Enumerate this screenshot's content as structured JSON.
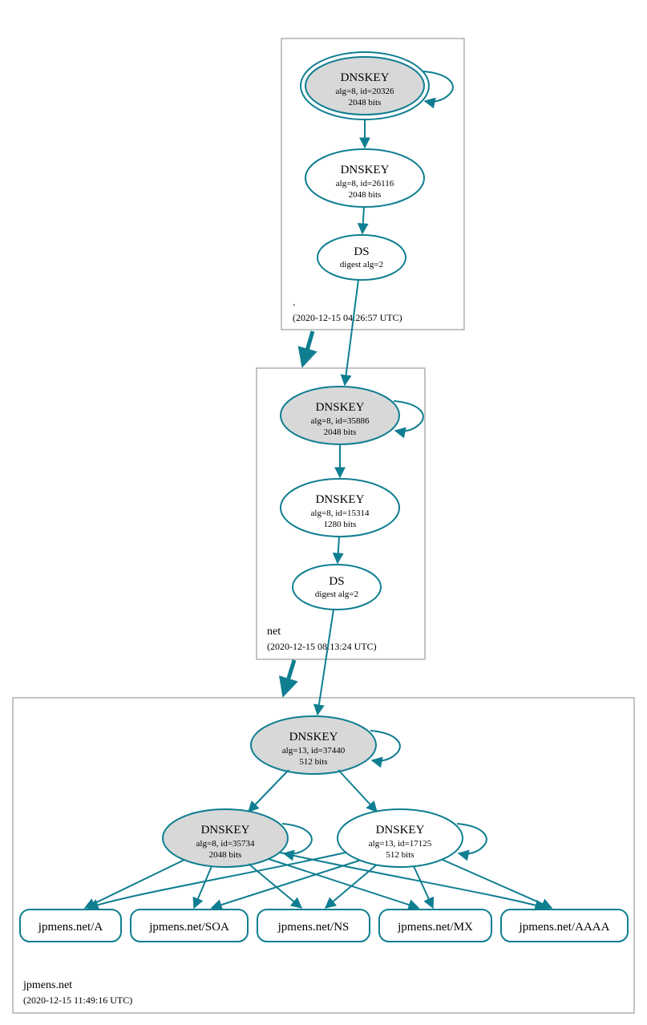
{
  "stroke_color": "#0f7e91",
  "fill_grey": "#d8d8d8",
  "fill_white": "#ffffff",
  "zones": {
    "root": {
      "label": ".",
      "timestamp": "(2020-12-15 04:26:57 UTC)"
    },
    "net": {
      "label": "net",
      "timestamp": "(2020-12-15 08:13:24 UTC)"
    },
    "leaf": {
      "label": "jpmens.net",
      "timestamp": "(2020-12-15 11:49:16 UTC)"
    }
  },
  "nodes": {
    "root_ksk": {
      "title": "DNSKEY",
      "line1": "alg=8, id=20326",
      "line2": "2048 bits"
    },
    "root_zsk": {
      "title": "DNSKEY",
      "line1": "alg=8, id=26116",
      "line2": "2048 bits"
    },
    "root_ds": {
      "title": "DS",
      "line1": "digest alg=2",
      "line2": ""
    },
    "net_ksk": {
      "title": "DNSKEY",
      "line1": "alg=8, id=35886",
      "line2": "2048 bits"
    },
    "net_zsk": {
      "title": "DNSKEY",
      "line1": "alg=8, id=15314",
      "line2": "1280 bits"
    },
    "net_ds": {
      "title": "DS",
      "line1": "digest alg=2",
      "line2": ""
    },
    "leaf_ksk": {
      "title": "DNSKEY",
      "line1": "alg=13, id=37440",
      "line2": "512 bits"
    },
    "leaf_k2": {
      "title": "DNSKEY",
      "line1": "alg=8, id=35734",
      "line2": "2048 bits"
    },
    "leaf_k3": {
      "title": "DNSKEY",
      "line1": "alg=13, id=17125",
      "line2": "512 bits"
    }
  },
  "rr": {
    "a": "jpmens.net/A",
    "soa": "jpmens.net/SOA",
    "ns": "jpmens.net/NS",
    "mx": "jpmens.net/MX",
    "aaaa": "jpmens.net/AAAA"
  }
}
